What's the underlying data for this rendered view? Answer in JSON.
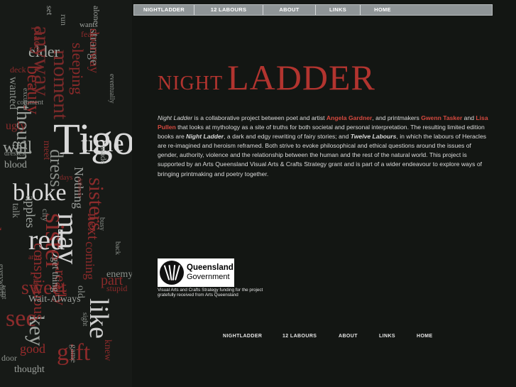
{
  "nav": {
    "items": [
      {
        "label": "NIGHTLADDER"
      },
      {
        "label": "12 LABOURS"
      },
      {
        "label": "ABOUT"
      },
      {
        "label": "LINKS"
      },
      {
        "label": "HOME"
      }
    ]
  },
  "title": {
    "night": "NIGHT",
    "ladder": "LADDER"
  },
  "intro": {
    "p1_title": "Night Ladder",
    "p1_a": " is a collaborative project between poet and artist ",
    "poet": "Angela Gardner",
    "p1_b": ", and printmakers ",
    "printmaker1": "Gwenn Tasker",
    "p1_c": " and ",
    "printmaker2": "Lisa Pullen",
    "p1_d": " that looks at mythology as a site of truths for both societal and personal interpretation. The resulting limited edition books are ",
    "book1": "Night Ladder",
    "p1_e": ", a dark and edgy rewriting of fairy stories; and ",
    "book2": "Twelve Labours",
    "p1_f": ", in which the labours of Heracles are re-imagined and heroism reframed. Both strive to evoke philosophical and ethical questions around the issues of gender, authority, violence and the relationship between the human and the rest of the natural world. This project is supported by an Arts Queensland Visual Arts & Crafts Strategy grant and is part of a wider endeavour to explore ways of bringing printmaking and poetry together."
  },
  "logo": {
    "line1": "Queensland",
    "line2": "Government",
    "caption": "Visual Arts and Crafts Strategy funding for the project gratefully received from Arts Queensland"
  },
  "bottom_nav": {
    "items": [
      {
        "label": "NIGHTLADDER"
      },
      {
        "label": "12 LABOURS"
      },
      {
        "label": "ABOUT"
      },
      {
        "label": "LINKS"
      },
      {
        "label": "HOME"
      }
    ]
  },
  "wordcloud": {
    "words": [
      {
        "t": "strange",
        "c": "#8a8f8a"
      },
      {
        "t": "moment",
        "c": "#7c2a2a"
      },
      {
        "t": "wants",
        "c": "#9ca09c"
      },
      {
        "t": "time",
        "c": "#e2e2e2"
      },
      {
        "t": "Tigo",
        "c": "#d9d9d9"
      },
      {
        "t": "may",
        "c": "#d4d4d4"
      },
      {
        "t": "sister",
        "c": "#8c2b2b"
      },
      {
        "t": "sisters",
        "c": "#8d2c2c"
      },
      {
        "t": "bloke",
        "c": "#dadada"
      },
      {
        "t": "red",
        "c": "#d6d6d6"
      },
      {
        "t": "dress",
        "c": "#8a8f8a"
      },
      {
        "t": "though",
        "c": "#9a9f9a"
      },
      {
        "t": "apples",
        "c": "#a0a5a0"
      },
      {
        "t": "beauty",
        "c": "#8c2a2a"
      },
      {
        "t": "elder",
        "c": "#a5aaa5"
      },
      {
        "t": "Nothing",
        "c": "#9ca09c"
      },
      {
        "t": "smooth",
        "c": "#8a8f8a"
      },
      {
        "t": "house",
        "c": "#8a2a2a"
      },
      {
        "t": "blood",
        "c": "#a0a5a0"
      },
      {
        "t": "sweet",
        "c": "#8c2b2b"
      },
      {
        "t": "see",
        "c": "#8d2c2c"
      },
      {
        "t": "good",
        "c": "#9a2b2b"
      },
      {
        "t": "thought",
        "c": "#9ca09c"
      },
      {
        "t": "door",
        "c": "#8a8f8a"
      },
      {
        "t": "gift",
        "c": "#8c2a2a"
      },
      {
        "t": "key",
        "c": "#a0a5a0"
      },
      {
        "t": "like",
        "c": "#d0d0d0"
      },
      {
        "t": "next",
        "c": "#8d2c2c"
      },
      {
        "t": "really",
        "c": "#8a2a2a"
      },
      {
        "t": "conspicuous",
        "c": "#8c2b2b"
      },
      {
        "t": "place",
        "c": "#8a2a2a"
      },
      {
        "t": "anyway",
        "c": "#7a2929"
      },
      {
        "t": "made",
        "c": "#9ca09c"
      },
      {
        "t": "meet",
        "c": "#8a2a2a"
      },
      {
        "t": "wanted",
        "c": "#8a8f8a"
      },
      {
        "t": "ugly",
        "c": "#8c2b2b"
      },
      {
        "t": "wall",
        "c": "#9ca09c"
      },
      {
        "t": "eventually",
        "c": "#8a8f8a"
      },
      {
        "t": "alone",
        "c": "#9ca09c"
      },
      {
        "t": "sleeping",
        "c": "#8a2a2a"
      },
      {
        "t": "old",
        "c": "#8a8f8a"
      },
      {
        "t": "city",
        "c": "#8a8f8a"
      },
      {
        "t": "Wait-Always",
        "c": "#9ca09c"
      },
      {
        "t": "get thing",
        "c": "#9ca09c"
      },
      {
        "t": "talk",
        "c": "#8a8f8a"
      },
      {
        "t": "everywhere",
        "c": "#8a8f8a"
      },
      {
        "t": "deck",
        "c": "#8a2a2a"
      },
      {
        "t": "days",
        "c": "#8a2a2a"
      },
      {
        "t": "arms",
        "c": "#8a2a2a"
      },
      {
        "t": "coming",
        "c": "#8a2a2a"
      },
      {
        "t": "stupid",
        "c": "#8a2a2a"
      },
      {
        "t": "back",
        "c": "#8a8f8a"
      },
      {
        "t": "busy",
        "c": "#8a8f8a"
      },
      {
        "t": "run",
        "c": "#8a8f8a"
      },
      {
        "t": "fear",
        "c": "#8a2a2a"
      },
      {
        "t": "set",
        "c": "#9ca09c"
      },
      {
        "t": "dresses",
        "c": "#8a8f8a"
      },
      {
        "t": "excuses",
        "c": "#8a8f8a"
      },
      {
        "t": "different",
        "c": "#8a2a2a"
      },
      {
        "t": "comment",
        "c": "#8a8f8a"
      },
      {
        "t": "sight",
        "c": "#8a8f8a"
      },
      {
        "t": "game",
        "c": "#8a8f8a"
      },
      {
        "t": "want",
        "c": "#8a8f8a"
      },
      {
        "t": "elders",
        "c": "#8a2a2a"
      },
      {
        "t": "enemy",
        "c": "#8a8f8a"
      },
      {
        "t": "part",
        "c": "#8a2a2a"
      },
      {
        "t": "knew",
        "c": "#8a2a2a"
      },
      {
        "t": "doorway",
        "c": "#8a2a2a"
      }
    ]
  }
}
